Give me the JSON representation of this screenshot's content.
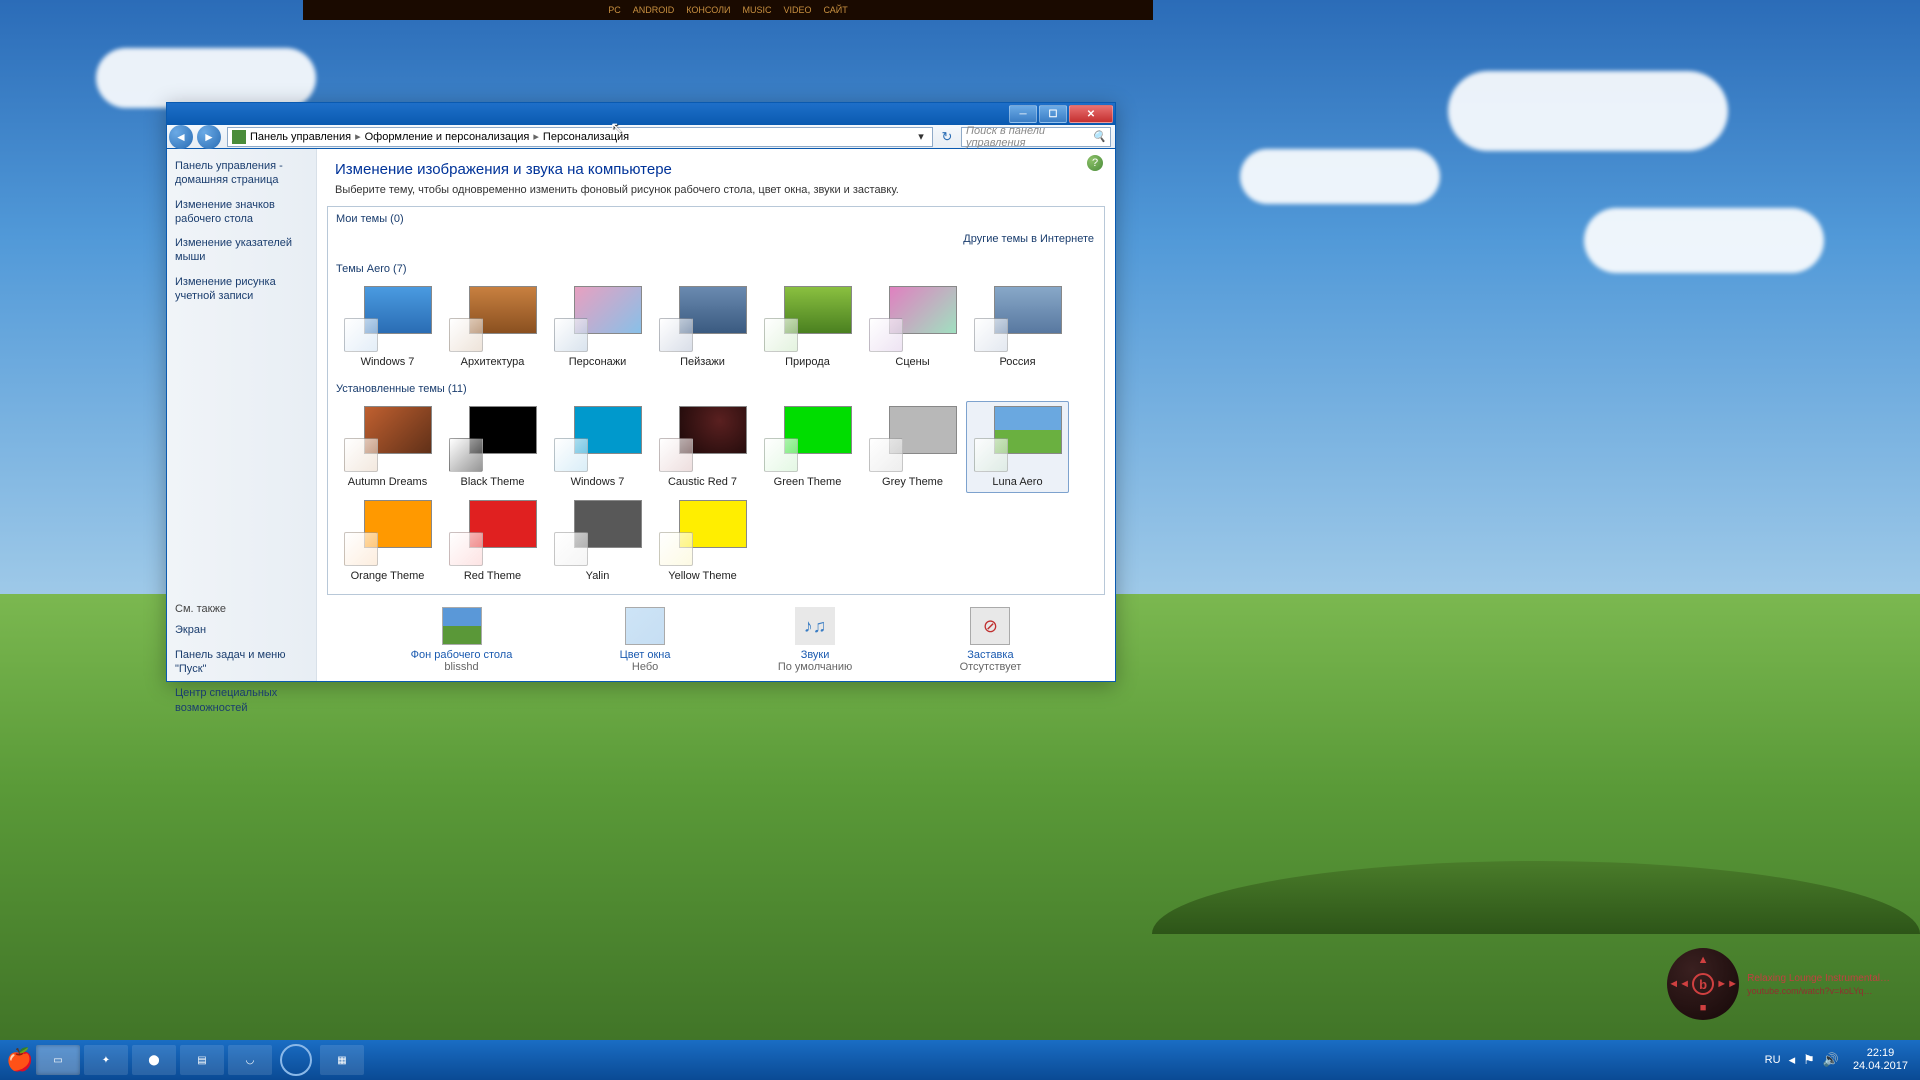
{
  "topBanner": {
    "items": [
      "PC",
      "ANDROID",
      "КОНСОЛИ",
      "MUSIC",
      "VIDEO",
      "САЙТ"
    ]
  },
  "breadcrumb": {
    "root": "Панель управления",
    "mid": "Оформление и персонализация",
    "leaf": "Персонализация"
  },
  "search": {
    "placeholder": "Поиск в панели управления"
  },
  "sidebar": {
    "links": [
      "Панель управления - домашняя страница",
      "Изменение значков рабочего стола",
      "Изменение указателей мыши",
      "Изменение рисунка учетной записи"
    ],
    "seeAlsoLabel": "См. также",
    "seeAlso": [
      "Экран",
      "Панель задач и меню \"Пуск\"",
      "Центр специальных возможностей"
    ]
  },
  "page": {
    "title": "Изменение изображения и звука на компьютере",
    "desc": "Выберите тему, чтобы одновременно изменить фоновый рисунок рабочего стола, цвет окна, звуки и заставку."
  },
  "sections": {
    "myThemes": "Мои темы (0)",
    "aero": "Темы Aero (7)",
    "installed": "Установленные темы (11)",
    "onlineLink": "Другие темы в Интернете"
  },
  "aeroThemes": [
    {
      "name": "Windows 7",
      "wp": "linear-gradient(to bottom,#4a9be0,#2a6db4)",
      "glass": "rgba(200,220,240,0.5)",
      "stack": false
    },
    {
      "name": "Архитектура",
      "wp": "linear-gradient(to bottom,#c88040,#8a5020)",
      "glass": "rgba(220,200,180,0.5)",
      "stack": true
    },
    {
      "name": "Персонажи",
      "wp": "linear-gradient(135deg,#e8a0c0,#88c0e8)",
      "glass": "rgba(180,200,220,0.5)",
      "stack": true
    },
    {
      "name": "Пейзажи",
      "wp": "linear-gradient(to bottom,#6a8ab0,#3a5a80)",
      "glass": "rgba(180,190,210,0.5)",
      "stack": true
    },
    {
      "name": "Природа",
      "wp": "linear-gradient(to bottom,#8ac040,#4a8020)",
      "glass": "rgba(200,230,190,0.5)",
      "stack": true
    },
    {
      "name": "Сцены",
      "wp": "linear-gradient(135deg,#e080c0,#a0e0c0)",
      "glass": "rgba(220,200,230,0.5)",
      "stack": true
    },
    {
      "name": "Россия",
      "wp": "linear-gradient(to bottom,#88a8c8,#5878a0)",
      "glass": "rgba(200,210,225,0.5)",
      "stack": true
    }
  ],
  "installedThemes": [
    {
      "name": "Autumn Dreams",
      "wp": "linear-gradient(135deg,#c06030,#603018)",
      "glass": "rgba(230,210,190,0.5)",
      "stack": true,
      "selected": false
    },
    {
      "name": "Black Theme",
      "wp": "#000000",
      "glass": "rgba(80,80,80,0.6)",
      "stack": false,
      "selected": false
    },
    {
      "name": "Windows 7",
      "wp": "#0099cc",
      "glass": "rgba(180,220,240,0.5)",
      "stack": false,
      "selected": false
    },
    {
      "name": "Caustic Red 7",
      "wp": "radial-gradient(circle at 60% 30%,#5a2020,#1a0808)",
      "glass": "rgba(220,190,190,0.5)",
      "stack": false,
      "selected": false
    },
    {
      "name": "Green Theme",
      "wp": "#00dd00",
      "glass": "rgba(200,240,200,0.5)",
      "stack": false,
      "selected": false
    },
    {
      "name": "Grey Theme",
      "wp": "#b8b8b8",
      "glass": "rgba(220,220,220,0.5)",
      "stack": false,
      "selected": false
    },
    {
      "name": "Luna Aero",
      "wp": "linear-gradient(to bottom,#6aa8e0 50%,#6ab040 50%)",
      "glass": "rgba(210,230,210,0.5)",
      "stack": false,
      "selected": true
    },
    {
      "name": "Orange Theme",
      "wp": "#ff9900",
      "glass": "rgba(250,220,190,0.5)",
      "stack": false,
      "selected": false
    },
    {
      "name": "Red Theme",
      "wp": "#e02020",
      "glass": "rgba(250,200,200,0.5)",
      "stack": false,
      "selected": false
    },
    {
      "name": "Yalin",
      "wp": "#585858",
      "glass": "rgba(235,235,235,0.5)",
      "stack": false,
      "selected": false
    },
    {
      "name": "Yellow Theme",
      "wp": "#ffee00",
      "glass": "rgba(250,245,200,0.5)",
      "stack": false,
      "selected": false
    }
  ],
  "settings": [
    {
      "label": "Фон рабочего стола",
      "value": "blisshd",
      "thumb": "linear-gradient(to bottom,#5a98d8 50%,#5a9838 50%)"
    },
    {
      "label": "Цвет окна",
      "value": "Небо",
      "thumb": "linear-gradient(135deg,rgba(200,225,245,0.9),rgba(160,200,235,0.6))"
    },
    {
      "label": "Звуки",
      "value": "По умолчанию",
      "thumb": "#e8e8e8"
    },
    {
      "label": "Заставка",
      "value": "Отсутствует",
      "thumb": "#e8e8e8"
    }
  ],
  "media": {
    "title": "Relaxing Lounge Instrumental…",
    "source": "youtube.com/watch?v=koLYq…"
  },
  "tray": {
    "lang": "RU",
    "time": "22:19",
    "date": "24.04.2017"
  }
}
